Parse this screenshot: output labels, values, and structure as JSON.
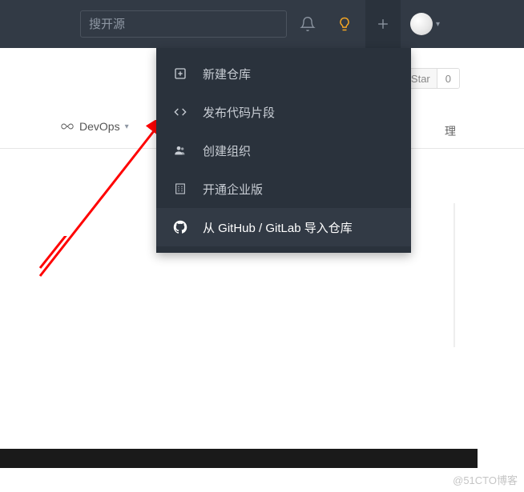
{
  "search": {
    "placeholder": "搜开源"
  },
  "star": {
    "label": "Star",
    "count": "0"
  },
  "tabs": {
    "devops": "DevOps"
  },
  "fragment": "理",
  "dropdown": {
    "items": [
      {
        "label": "新建仓库"
      },
      {
        "label": "发布代码片段"
      },
      {
        "label": "创建组织"
      },
      {
        "label": "开通企业版"
      },
      {
        "label": "从 GitHub / GitLab 导入仓库"
      }
    ]
  },
  "watermark": "@51CTO博客"
}
